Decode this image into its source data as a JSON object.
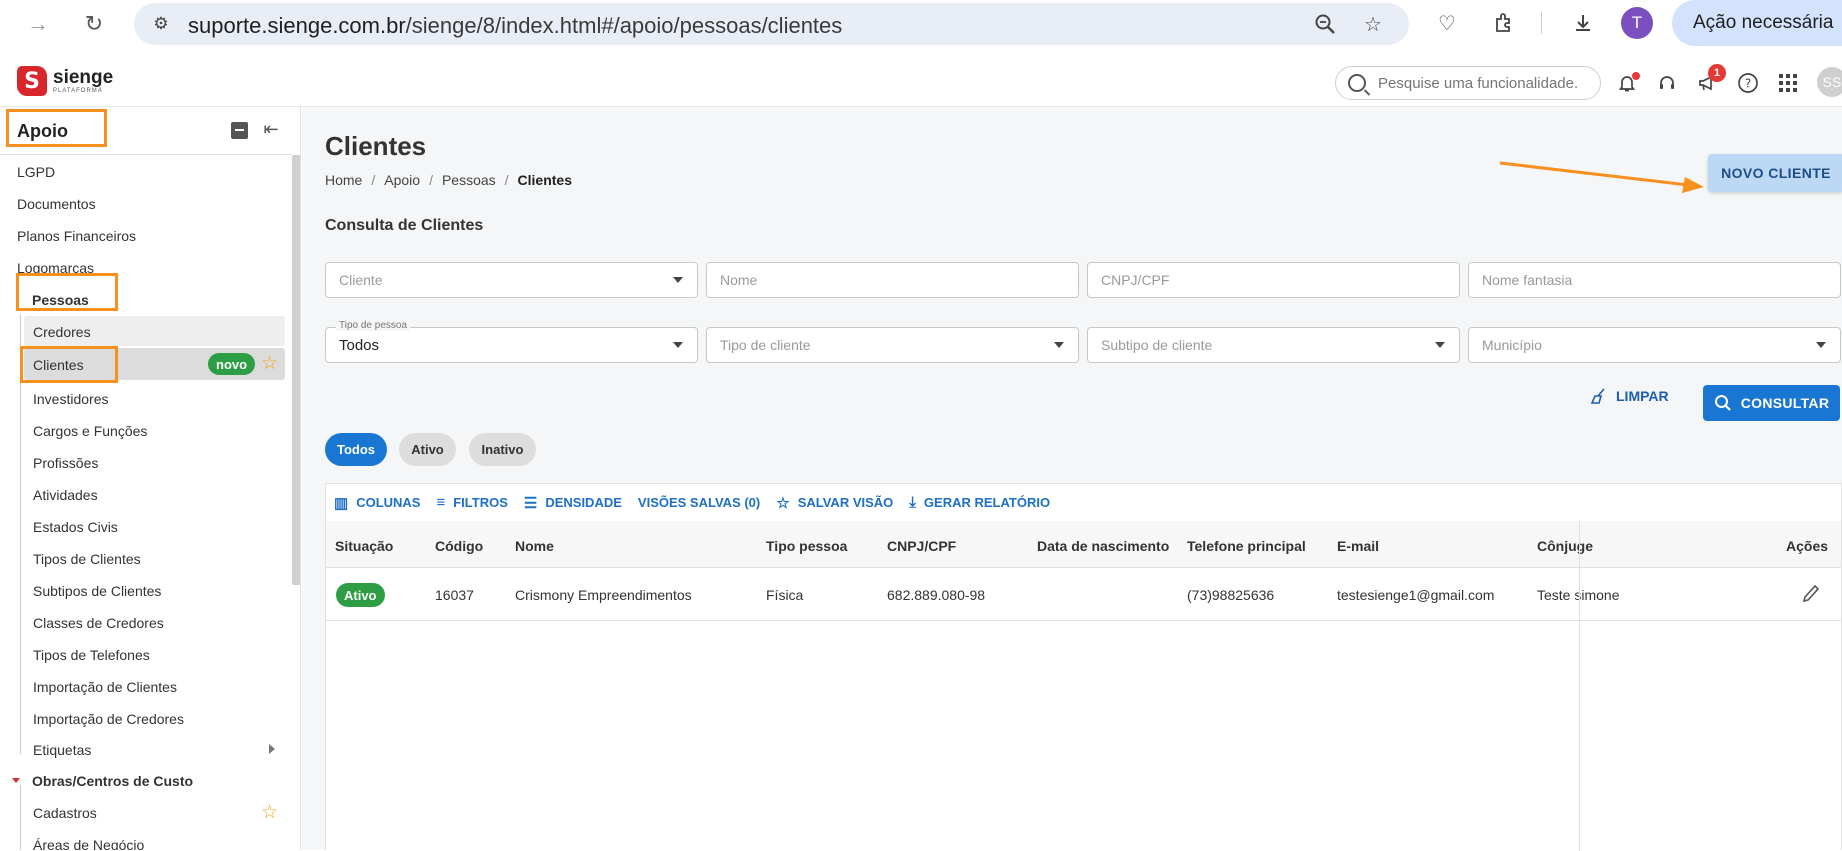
{
  "browser": {
    "url_host": "suporte.sienge.com.br",
    "url_path": "/sienge/8/index.html#/apoio/pessoas/clientes",
    "avatar_letter": "T",
    "action_required": "Ação necessária"
  },
  "header": {
    "logo_name": "sienge",
    "logo_sub": "PLATAFORMA",
    "search_placeholder": "Pesquise uma funcionalidade.",
    "notification_badge": "1",
    "user_initials": "SS"
  },
  "sidebar": {
    "title": "Apoio",
    "items": [
      {
        "label": "LGPD"
      },
      {
        "label": "Documentos"
      },
      {
        "label": "Planos Financeiros"
      },
      {
        "label": "Logomarcas"
      },
      {
        "label": "Pessoas"
      },
      {
        "label": "Credores"
      },
      {
        "label": "Clientes",
        "badge": "novo"
      },
      {
        "label": "Investidores"
      },
      {
        "label": "Cargos e Funções"
      },
      {
        "label": "Profissões"
      },
      {
        "label": "Atividades"
      },
      {
        "label": "Estados Civis"
      },
      {
        "label": "Tipos de Clientes"
      },
      {
        "label": "Subtipos de Clientes"
      },
      {
        "label": "Classes de Credores"
      },
      {
        "label": "Tipos de Telefones"
      },
      {
        "label": "Importação de Clientes"
      },
      {
        "label": "Importação de Credores"
      },
      {
        "label": "Etiquetas"
      },
      {
        "label": "Obras/Centros de Custo"
      },
      {
        "label": "Cadastros"
      },
      {
        "label": "Áreas de Negócio"
      }
    ]
  },
  "page": {
    "title": "Clientes",
    "breadcrumb": [
      "Home",
      "/",
      "Apoio",
      "/",
      "Pessoas",
      "/",
      "Clientes"
    ],
    "new_button": "NOVO CLIENTE",
    "subtitle": "Consulta de Clientes",
    "filters": {
      "cliente": "Cliente",
      "nome": "Nome",
      "cnpj": "CNPJ/CPF",
      "fantasia": "Nome fantasia",
      "tipo_pessoa_label": "Tipo de pessoa",
      "tipo_pessoa_value": "Todos",
      "tipo_cliente": "Tipo de cliente",
      "subtipo_cliente": "Subtipo de cliente",
      "municipio": "Município"
    },
    "clear_button": "LIMPAR",
    "search_button": "CONSULTAR",
    "chips": [
      "Todos",
      "Ativo",
      "Inativo"
    ]
  },
  "grid": {
    "toolbar": [
      "COLUNAS",
      "FILTROS",
      "DENSIDADE",
      "VISÕES SALVAS (0)",
      "SALVAR VISÃO",
      "GERAR RELATÓRIO"
    ],
    "columns": [
      "Situação",
      "Código",
      "Nome",
      "Tipo pessoa",
      "CNPJ/CPF",
      "Data de nascimento",
      "Telefone principal",
      "E-mail",
      "Cônjuge",
      "Ações"
    ],
    "rows": [
      {
        "situacao": "Ativo",
        "codigo": "16037",
        "nome": "Crismony Empreendimentos",
        "tipo_pessoa": "Física",
        "cnpj": "682.889.080-98",
        "nascimento": "",
        "telefone": "(73)98825636",
        "email": "testesienge1@gmail.com",
        "conjuge": "Teste simone"
      }
    ]
  },
  "colors": {
    "accent": "#1976d2",
    "highlight": "#f7901e",
    "status_active": "#2e9e44",
    "brand": "#d8262b"
  }
}
